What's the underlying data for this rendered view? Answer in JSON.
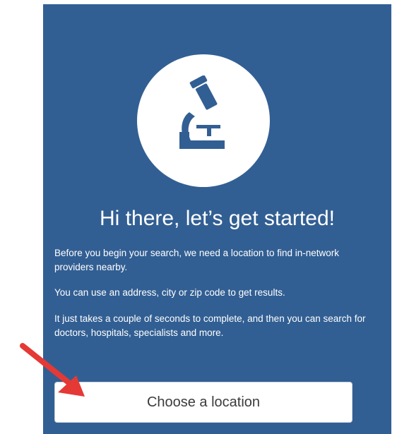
{
  "onboarding": {
    "title": "Hi there, let’s get started!",
    "paragraphs": [
      "Before you begin your search, we need a location to find in-network providers nearby.",
      "You can use an address, city or zip code to get results.",
      "It just takes a couple of seconds to complete, and then you can search for doctors, hospitals, specialists and more."
    ],
    "cta_label": "Choose a location",
    "icon": "microscope-icon",
    "annotation_icon": "red-arrow-icon"
  },
  "colors": {
    "card_background": "#325f93",
    "icon_color": "#325f93",
    "text": "#ffffff",
    "annotation_arrow": "#e53935"
  }
}
